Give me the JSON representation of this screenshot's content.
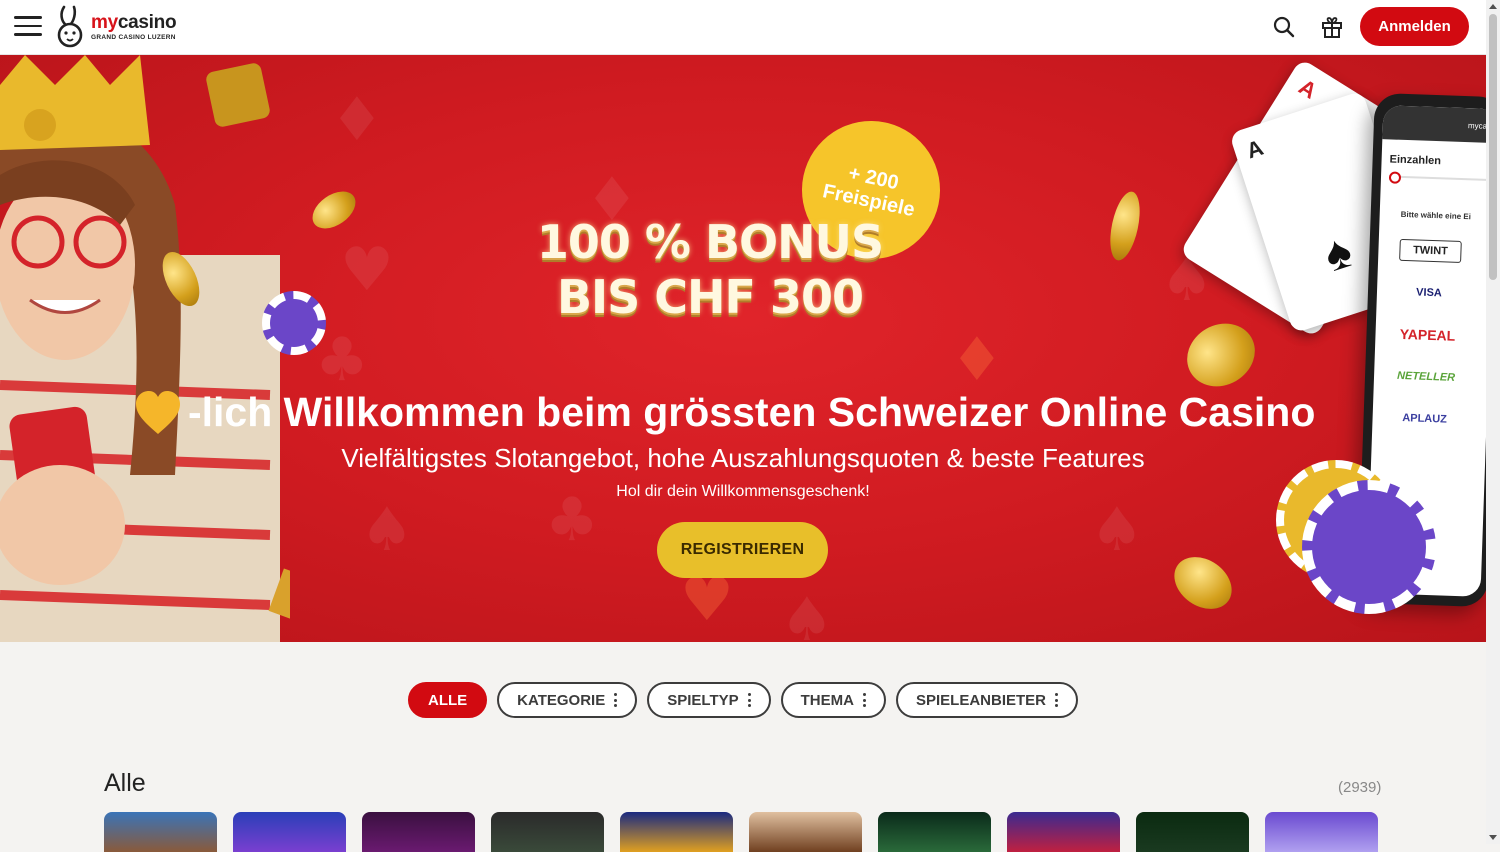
{
  "header": {
    "brand_name_prefix": "my",
    "brand_name_suffix": "casino",
    "brand_sub": "GRAND CASINO LUZERN",
    "login_label": "Anmelden"
  },
  "hero": {
    "bonus_line1": "100 % BONUS",
    "bonus_line2": "BIS CHF 300",
    "badge_line1": "+ 200",
    "badge_line2": "Freispiele",
    "welcome": "-lich Willkommen beim grössten Schweizer Online Casino",
    "subtitle": "Vielfältigstes Slotangebot, hohe Auszahlungsquoten & beste Features",
    "subtext": "Hol dir dein Willkommensgeschenk!",
    "register_label": "REGISTRIEREN",
    "phone": {
      "brand": "mycasi",
      "title": "Einzahlen",
      "hint": "Bitte wähle eine Ei",
      "payments": [
        "TWINT",
        "VISA",
        "YAPEAL",
        "NETELLER",
        "APLAUZ"
      ]
    }
  },
  "filters": {
    "items": [
      "ALLE",
      "KATEGORIE",
      "SPIELTYP",
      "THEMA",
      "SPIELEANBIETER"
    ]
  },
  "section": {
    "title": "Alle",
    "count": "(2939)"
  },
  "colors": {
    "brand_red": "#d20a11",
    "gold": "#e8bf2a",
    "hero_bg": "#d01b21"
  }
}
